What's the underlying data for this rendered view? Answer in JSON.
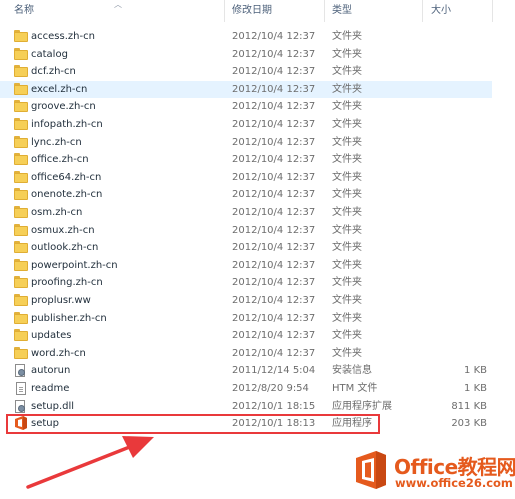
{
  "columns": {
    "name": "名称",
    "date": "修改日期",
    "type": "类型",
    "size": "大小"
  },
  "files": [
    {
      "name": "access.zh-cn",
      "date": "2012/10/4 12:37",
      "type": "文件夹",
      "size": "",
      "icon": "folder-icon"
    },
    {
      "name": "catalog",
      "date": "2012/10/4 12:37",
      "type": "文件夹",
      "size": "",
      "icon": "folder-icon"
    },
    {
      "name": "dcf.zh-cn",
      "date": "2012/10/4 12:37",
      "type": "文件夹",
      "size": "",
      "icon": "folder-icon"
    },
    {
      "name": "excel.zh-cn",
      "date": "2012/10/4 12:37",
      "type": "文件夹",
      "size": "",
      "icon": "folder-icon",
      "selected": true
    },
    {
      "name": "groove.zh-cn",
      "date": "2012/10/4 12:37",
      "type": "文件夹",
      "size": "",
      "icon": "folder-icon"
    },
    {
      "name": "infopath.zh-cn",
      "date": "2012/10/4 12:37",
      "type": "文件夹",
      "size": "",
      "icon": "folder-icon"
    },
    {
      "name": "lync.zh-cn",
      "date": "2012/10/4 12:37",
      "type": "文件夹",
      "size": "",
      "icon": "folder-icon"
    },
    {
      "name": "office.zh-cn",
      "date": "2012/10/4 12:37",
      "type": "文件夹",
      "size": "",
      "icon": "folder-icon"
    },
    {
      "name": "office64.zh-cn",
      "date": "2012/10/4 12:37",
      "type": "文件夹",
      "size": "",
      "icon": "folder-icon"
    },
    {
      "name": "onenote.zh-cn",
      "date": "2012/10/4 12:37",
      "type": "文件夹",
      "size": "",
      "icon": "folder-icon"
    },
    {
      "name": "osm.zh-cn",
      "date": "2012/10/4 12:37",
      "type": "文件夹",
      "size": "",
      "icon": "folder-icon"
    },
    {
      "name": "osmux.zh-cn",
      "date": "2012/10/4 12:37",
      "type": "文件夹",
      "size": "",
      "icon": "folder-icon"
    },
    {
      "name": "outlook.zh-cn",
      "date": "2012/10/4 12:37",
      "type": "文件夹",
      "size": "",
      "icon": "folder-icon"
    },
    {
      "name": "powerpoint.zh-cn",
      "date": "2012/10/4 12:37",
      "type": "文件夹",
      "size": "",
      "icon": "folder-icon"
    },
    {
      "name": "proofing.zh-cn",
      "date": "2012/10/4 12:37",
      "type": "文件夹",
      "size": "",
      "icon": "folder-icon"
    },
    {
      "name": "proplusr.ww",
      "date": "2012/10/4 12:37",
      "type": "文件夹",
      "size": "",
      "icon": "folder-icon"
    },
    {
      "name": "publisher.zh-cn",
      "date": "2012/10/4 12:37",
      "type": "文件夹",
      "size": "",
      "icon": "folder-icon"
    },
    {
      "name": "updates",
      "date": "2012/10/4 12:37",
      "type": "文件夹",
      "size": "",
      "icon": "folder-icon"
    },
    {
      "name": "word.zh-cn",
      "date": "2012/10/4 12:37",
      "type": "文件夹",
      "size": "",
      "icon": "folder-icon"
    },
    {
      "name": "autorun",
      "date": "2011/12/14 5:04",
      "type": "安装信息",
      "size": "1 KB",
      "icon": "settings-file-icon"
    },
    {
      "name": "readme",
      "date": "2012/8/20 9:54",
      "type": "HTM 文件",
      "size": "1 KB",
      "icon": "document-icon"
    },
    {
      "name": "setup.dll",
      "date": "2012/10/1 18:15",
      "type": "应用程序扩展",
      "size": "811 KB",
      "icon": "settings-file-icon"
    },
    {
      "name": "setup",
      "date": "2012/10/1 18:13",
      "type": "应用程序",
      "size": "203 KB",
      "icon": "office-setup-icon"
    }
  ],
  "watermark": {
    "brand": "Office教程网",
    "url": "www.office26.com"
  },
  "colors": {
    "highlight": "#e9393b",
    "arrow": "#e9393b",
    "brand": "#e55a1d",
    "selected_row": "#e5f3ff",
    "folder": "#f6cf57"
  }
}
